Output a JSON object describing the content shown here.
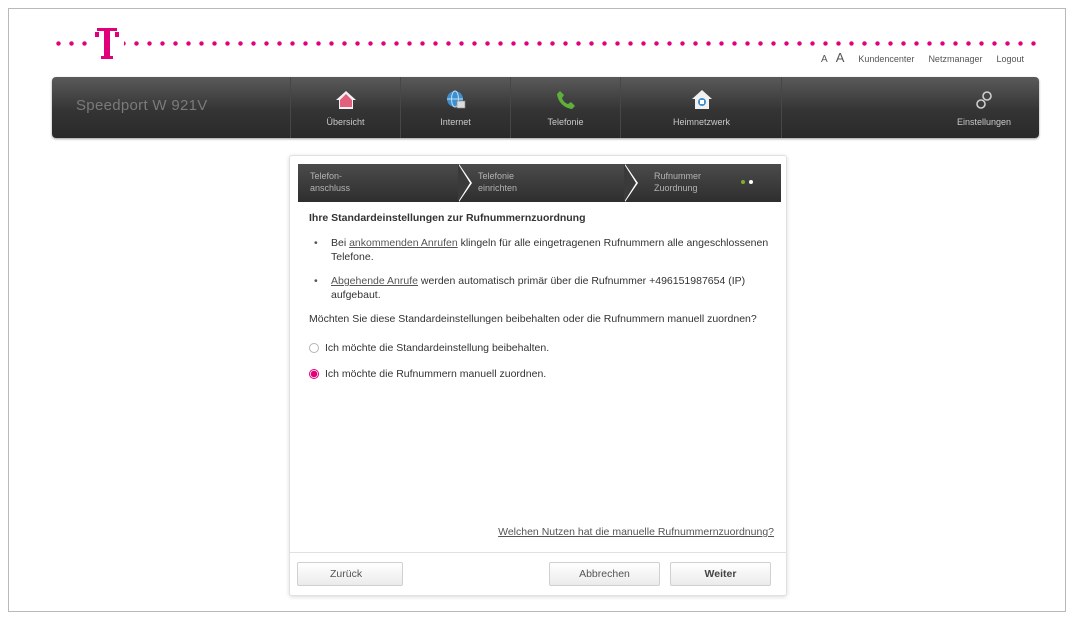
{
  "toplinks": {
    "font_small": "A",
    "font_large": "A",
    "kundencenter": "Kundencenter",
    "netzmanager": "Netzmanager",
    "logout": "Logout"
  },
  "navbar": {
    "device_name": "Speedport W 921V",
    "items": [
      {
        "label": "Übersicht",
        "icon": "house-icon"
      },
      {
        "label": "Internet",
        "icon": "globe-icon"
      },
      {
        "label": "Telefonie",
        "icon": "phone-icon"
      },
      {
        "label": "Heimnetzwerk",
        "icon": "home-network-icon"
      },
      {
        "label": "Einstellungen",
        "icon": "settings-icon"
      }
    ]
  },
  "wizard": {
    "steps": [
      {
        "line1": "Telefon-",
        "line2": "anschluss"
      },
      {
        "line1": "Telefonie",
        "line2": "einrichten"
      },
      {
        "line1": "Rufnummer",
        "line2": "Zuordnung"
      }
    ],
    "heading": "Ihre Standardeinstellungen zur Rufnummernzuordnung",
    "bullet1": {
      "prefix": "Bei ",
      "link": "ankommenden Anrufen",
      "suffix": " klingeln für alle eingetragenen Rufnummern alle angeschlossenen Telefone."
    },
    "bullet2": {
      "link": "Abgehende Anrufe",
      "suffix": " werden automatisch primär über die Rufnummer +496151987654 (IP) aufgebaut."
    },
    "question": "Möchten Sie diese Standardeinstellungen beibehalten oder die Rufnummern manuell zuordnen?",
    "options": [
      {
        "label": "Ich möchte die Standardeinstellung beibehalten.",
        "checked": false
      },
      {
        "label": "Ich möchte die Rufnummern manuell zuordnen.",
        "checked": true
      }
    ],
    "help_link": "Welchen Nutzen hat die manuelle Rufnummernzuordnung?",
    "buttons": {
      "back": "Zurück",
      "cancel": "Abbrechen",
      "next": "Weiter"
    }
  },
  "colors": {
    "brand_magenta": "#e2007a",
    "navbar_dark": "#343434"
  }
}
